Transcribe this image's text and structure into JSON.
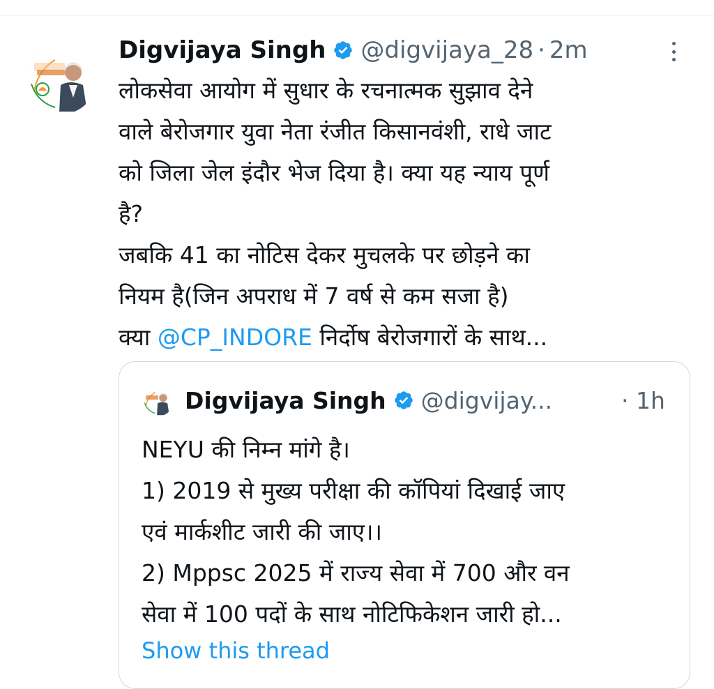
{
  "tweet": {
    "author_name": "Digvijaya Singh",
    "handle": "@digvijaya_28",
    "separator": "·",
    "time": "2m",
    "lines": [
      "लोकसेवा आयोग में सुधार के रचनात्मक सुझाव  देने",
      "वाले बेरोजगार युवा नेता रंजीत किसानवंशी, राधे जाट",
      "को जिला जेल इंदौर भेज दिया है। क्या यह न्याय पूर्ण",
      "है?",
      "जबकि 41 का नोटिस देकर मुचलके पर छोड़ने का",
      "नियम है(जिन अपराध में 7 वर्ष से कम सजा है)"
    ],
    "last_line_prefix": "क्या ",
    "mention": "@CP_INDORE",
    "last_line_suffix": " निर्दोष बेरोजगारों के साथ..."
  },
  "quoted": {
    "author_name": "Digvijaya Singh",
    "handle": "@digvijay...",
    "time": "· 1h",
    "lines": [
      "NEYU की निम्न मांगे है।",
      "1) 2019 से मुख्य परीक्षा की कॉपियां दिखाई जाए",
      "एवं मार्कशीट जारी की जाए।।",
      "2) Mppsc 2025 में राज्य सेवा में 700 और वन",
      "सेवा में 100 पदों के साथ नोटिफिकेशन जारी हो..."
    ],
    "show_thread": "Show this thread"
  },
  "colors": {
    "accent": "#1d9bf0",
    "text": "#0f1419",
    "secondary": "#536471",
    "border": "#cfd9de"
  },
  "icons": {
    "verified": "verified-badge-icon",
    "more": "more-options-icon"
  }
}
